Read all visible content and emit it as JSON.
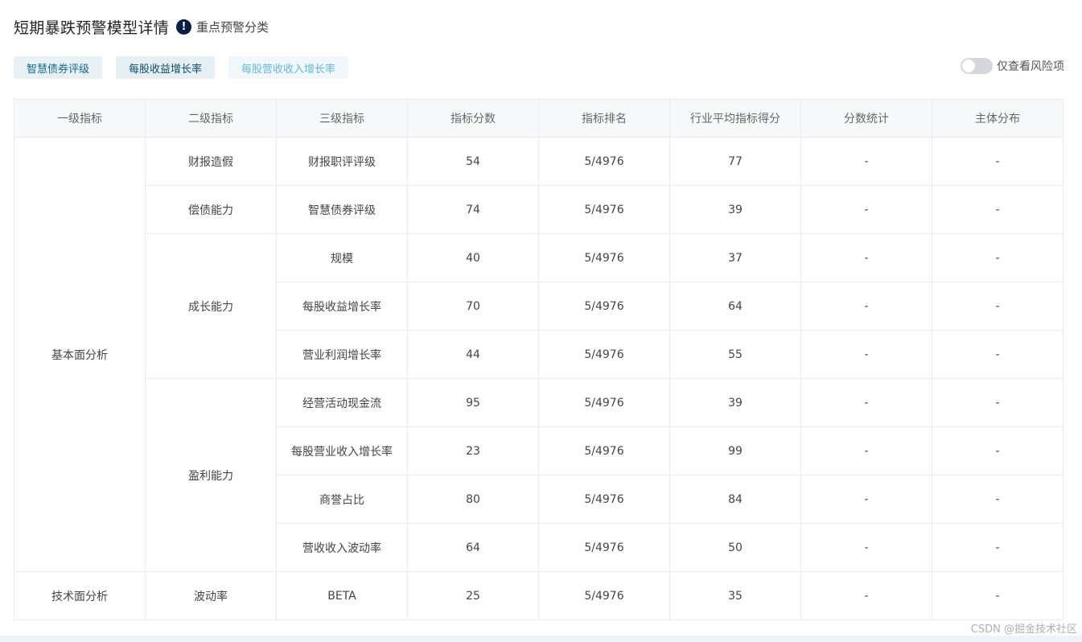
{
  "header": {
    "title": "短期暴跌预警模型详情",
    "info_icon": "!",
    "subtitle": "重点预警分类"
  },
  "tabs": [
    {
      "label": "智慧债券评级"
    },
    {
      "label": "每股收益增长率"
    },
    {
      "label": "每股营收收入增长率"
    }
  ],
  "toggle": {
    "label": "仅查看风险项",
    "on": false
  },
  "table": {
    "columns": [
      "一级指标",
      "二级指标",
      "三级指标",
      "指标分数",
      "指标排名",
      "行业平均指标得分",
      "分数统计",
      "主体分布"
    ],
    "groups": [
      {
        "level1": "基本面分析",
        "subgroups": [
          {
            "level2": "财报造假",
            "rows": [
              {
                "level3": "财报职评评级",
                "score": "54",
                "rank": "5/4976",
                "avg": "77",
                "stat": "-",
                "dist": "-"
              }
            ]
          },
          {
            "level2": "偿债能力",
            "rows": [
              {
                "level3": "智慧债券评级",
                "score": "74",
                "rank": "5/4976",
                "avg": "39",
                "stat": "-",
                "dist": "-"
              }
            ]
          },
          {
            "level2": "成长能力",
            "rows": [
              {
                "level3": "规模",
                "score": "40",
                "rank": "5/4976",
                "avg": "37",
                "stat": "-",
                "dist": "-"
              },
              {
                "level3": "每股收益增长率",
                "score": "70",
                "rank": "5/4976",
                "avg": "64",
                "stat": "-",
                "dist": "-"
              },
              {
                "level3": "营业利润增长率",
                "score": "44",
                "rank": "5/4976",
                "avg": "55",
                "stat": "-",
                "dist": "-"
              }
            ]
          },
          {
            "level2": "盈利能力",
            "rows": [
              {
                "level3": "经营活动现金流",
                "score": "95",
                "rank": "5/4976",
                "avg": "39",
                "stat": "-",
                "dist": "-"
              },
              {
                "level3": "每股营业收入增长率",
                "score": "23",
                "rank": "5/4976",
                "avg": "99",
                "stat": "-",
                "dist": "-"
              },
              {
                "level3": "商誉占比",
                "score": "80",
                "rank": "5/4976",
                "avg": "84",
                "stat": "-",
                "dist": "-"
              },
              {
                "level3": "营收收入波动率",
                "score": "64",
                "rank": "5/4976",
                "avg": "50",
                "stat": "-",
                "dist": "-"
              }
            ]
          }
        ]
      },
      {
        "level1": "技术面分析",
        "subgroups": [
          {
            "level2": "波动率",
            "rows": [
              {
                "level3": "BETA",
                "score": "25",
                "rank": "5/4976",
                "avg": "35",
                "stat": "-",
                "dist": "-"
              }
            ]
          }
        ]
      }
    ]
  },
  "watermark": "CSDN @掘金技术社区",
  "colors": {
    "accent": "#0d1e46",
    "tab_text": "#126b8f",
    "border": "#e8ebef",
    "header_bg": "#f7f8fa"
  }
}
